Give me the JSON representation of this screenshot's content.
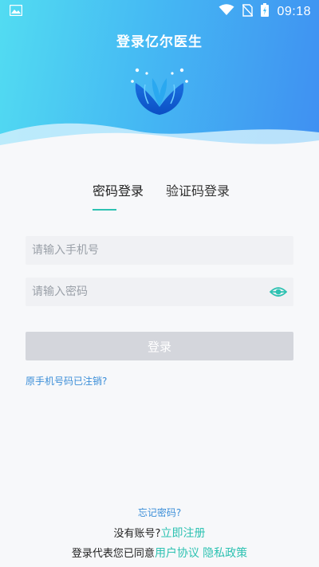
{
  "status_bar": {
    "time": "09:18"
  },
  "app_title": "登录亿尔医生",
  "tabs": [
    {
      "label": "密码登录",
      "active": true
    },
    {
      "label": "验证码登录",
      "active": false
    }
  ],
  "phone_field": {
    "placeholder": "请输入手机号",
    "value": ""
  },
  "password_field": {
    "placeholder": "请输入密码",
    "value": ""
  },
  "login_button": {
    "label": "登录",
    "enabled": false
  },
  "links": {
    "cancelled_number": "原手机号码已注销?",
    "forgot_password": "忘记密码?",
    "no_account": "没有账号?",
    "register_now": "立即注册",
    "agree_prefix": "登录代表您已同意",
    "user_agreement": "用户协议",
    "privacy_policy": "隐私政策"
  },
  "icons": [
    "image-icon",
    "wifi-icon",
    "no-sim-icon",
    "battery-icon",
    "logo-icon",
    "eye-icon"
  ],
  "colors": {
    "accent": "#2ec2b2",
    "link": "#3b8ed8",
    "button_disabled": "#d4d6dc",
    "header_gradient_start": "#52dcf2",
    "header_gradient_end": "#3f8ff2"
  }
}
